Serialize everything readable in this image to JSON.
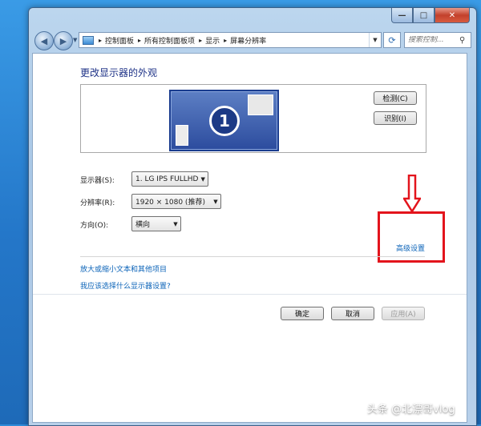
{
  "window": {
    "breadcrumbs": [
      "控制面板",
      "所有控制面板项",
      "显示",
      "屏幕分辨率"
    ],
    "search_placeholder": "搜索控制...",
    "controls": {
      "minimize": "—",
      "maximize": "□",
      "close": "✕"
    }
  },
  "page": {
    "heading": "更改显示器的外观",
    "monitor_number": "1",
    "detect_button": "检测(C)",
    "identify_button": "识别(I)",
    "display_label": "显示器(S):",
    "display_value": "1. LG IPS FULLHD",
    "resolution_label": "分辨率(R):",
    "resolution_value": "1920 × 1080 (推荐)",
    "orientation_label": "方向(O):",
    "orientation_value": "横向",
    "advanced_link": "高级设置",
    "link_text_size": "放大或缩小文本和其他项目",
    "link_which_settings": "我应该选择什么显示器设置?",
    "ok_button": "确定",
    "cancel_button": "取消",
    "apply_button": "应用(A)"
  },
  "watermark": "头条 @北漂哥vlog",
  "colors": {
    "annotation": "#e3141c",
    "link": "#0b63b8",
    "heading": "#1e3287"
  }
}
